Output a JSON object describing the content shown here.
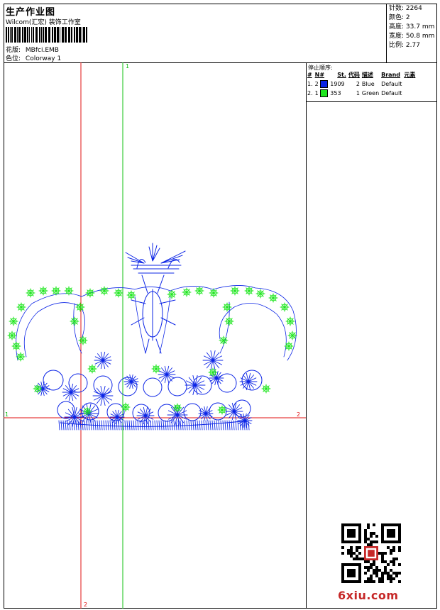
{
  "header": {
    "title": "生产作业图",
    "subtitle": "Wilcom(汇宏) 装饰工作室",
    "design_label": "花版:",
    "design_value": "MBfci.EMB",
    "colorway_label": "色位:",
    "colorway_value": "Colorway 1"
  },
  "stats": [
    {
      "label": "针数:",
      "value": "2264"
    },
    {
      "label": "颜色:",
      "value": "2"
    },
    {
      "label": "高度:",
      "value": "33.7 mm"
    },
    {
      "label": "宽度:",
      "value": "50.8 mm"
    },
    {
      "label": "比例:",
      "value": "2.77"
    }
  ],
  "stop_sequence": {
    "title": "停止顺序:",
    "columns": [
      "#",
      "N#",
      "St.",
      "代码",
      "描述",
      "Brand",
      "元素"
    ],
    "rows": [
      {
        "num": "1.",
        "n": "2",
        "swatch": "#0b24e6",
        "stitches": "1909",
        "code": "2",
        "desc": "Blue",
        "brand": "Default",
        "elem": ""
      },
      {
        "num": "2.",
        "n": "1",
        "swatch": "#1ee61e",
        "stitches": "353",
        "code": "1",
        "desc": "Green",
        "brand": "Default",
        "elem": ""
      }
    ]
  },
  "axes": {
    "h_label_left": "1",
    "h_label_right": "2",
    "v_label_top": "1",
    "v_label_bottom": "2"
  },
  "colors": {
    "blue_thread": "#0b24e6",
    "green_thread": "#1ee61e",
    "red_axis": "#e01010",
    "green_axis": "#10c010"
  },
  "watermark": "6xiu.com",
  "icons": {
    "qr": "qr-code-icon",
    "barcode": "barcode-icon"
  }
}
